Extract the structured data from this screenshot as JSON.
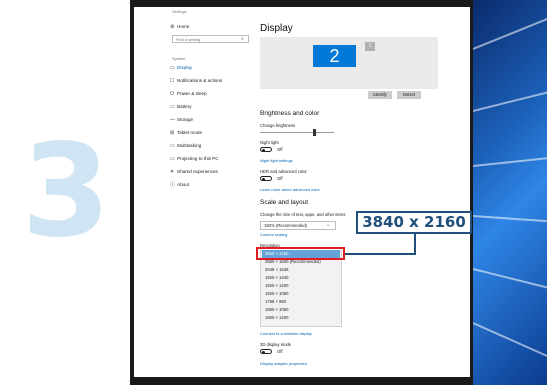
{
  "big_step_number": "3",
  "callout_text": "3840 x 2160",
  "settings": {
    "title": "Settings",
    "home": "Home",
    "search_placeholder": "Find a setting",
    "section": "System",
    "nav": [
      {
        "icon": "▭",
        "label": "Display",
        "active": true
      },
      {
        "icon": "☐",
        "label": "Notifications & actions"
      },
      {
        "icon": "⏻",
        "label": "Power & sleep"
      },
      {
        "icon": "▭",
        "label": "Battery"
      },
      {
        "icon": "—",
        "label": "Storage"
      },
      {
        "icon": "⊞",
        "label": "Tablet mode"
      },
      {
        "icon": "▭",
        "label": "Multitasking"
      },
      {
        "icon": "▭",
        "label": "Projecting to this PC"
      },
      {
        "icon": "✕",
        "label": "Shared experiences"
      },
      {
        "icon": "ⓘ",
        "label": "About"
      }
    ]
  },
  "display": {
    "title": "Display",
    "monitor_main": "2",
    "monitor_secondary": "1",
    "identify": "Identify",
    "detect": "Detect",
    "brightness_title": "Brightness and color",
    "change_brightness": "Change brightness",
    "night_light": "Night light",
    "night_light_state": "Off",
    "night_light_settings": "Night light settings",
    "hdr_label": "HDR and advanced color",
    "hdr_state": "Off",
    "learn_more": "Learn more about advanced color",
    "scale_title": "Scale and layout",
    "scale_label": "Change the size of text, apps, and other items",
    "scale_value": "150% (Recommended)",
    "custom_scaling": "Custom scaling",
    "resolution_label": "Resolution",
    "resolution_options": [
      "3840 × 2160",
      "2560 × 1600 (Recommended)",
      "2048 × 1536",
      "1920 × 1440",
      "1920 × 1200",
      "1920 × 1080",
      "1768 × 992",
      "1680 × 1050",
      "1600 × 1200"
    ],
    "wireless_link": "Connect to a wireless display",
    "three_d_label": "3D display mode",
    "three_d_state": "Off",
    "adapter_link": "Display adapter properties"
  }
}
